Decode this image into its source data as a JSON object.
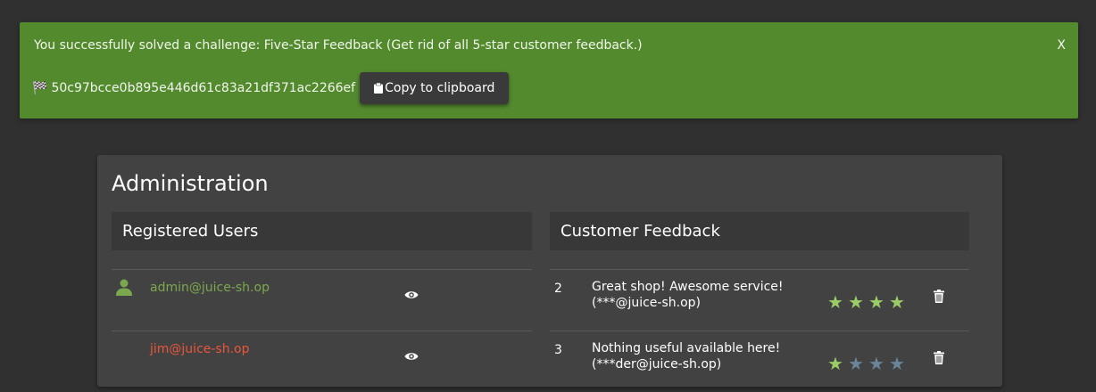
{
  "banner": {
    "message": "You successfully solved a challenge: Five-Star Feedback (Get rid of all 5-star customer feedback.)",
    "close_label": "X",
    "flag_icon": "checkered-flag-icon",
    "code": "50c97bcce0b895e446d61c83a21df371ac2266ef",
    "copy_label": "Copy to clipboard",
    "background": "#548a2e"
  },
  "admin": {
    "title": "Administration",
    "users": {
      "heading": "Registered Users",
      "rows": [
        {
          "email": "admin@juice-sh.op",
          "color": "#7ba84e",
          "icon": "user-icon"
        },
        {
          "email": "jim@juice-sh.op",
          "color": "#e8563b",
          "icon": ""
        }
      ]
    },
    "feedback": {
      "heading": "Customer Feedback",
      "rows": [
        {
          "id": "2",
          "text_line1": "Great shop! Awesome service!",
          "text_line2": "(***@juice-sh.op)",
          "rating": 4
        },
        {
          "id": "3",
          "text_line1": "Nothing useful available here!",
          "text_line2": "(***der@juice-sh.op)",
          "rating": 1
        }
      ],
      "star_color_on": "#9ccc65",
      "star_color_off": "#6a8499"
    }
  }
}
